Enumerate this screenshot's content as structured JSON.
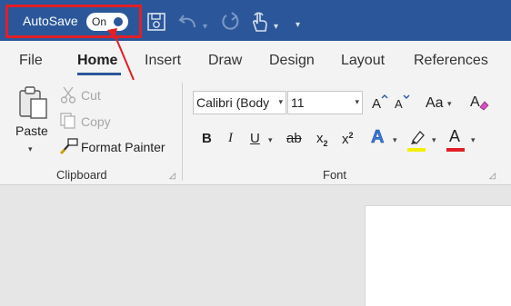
{
  "titlebar": {
    "autosave_label": "AutoSave",
    "autosave_state": "On",
    "icons": [
      "save-icon",
      "undo-icon",
      "redo-icon",
      "touch-mode-icon",
      "customize-toolbar-icon"
    ]
  },
  "tabs": {
    "file": "File",
    "home": "Home",
    "insert": "Insert",
    "draw": "Draw",
    "design": "Design",
    "layout": "Layout",
    "references": "References"
  },
  "clipboard": {
    "paste": "Paste",
    "cut": "Cut",
    "copy": "Copy",
    "format_painter": "Format Painter",
    "group_label": "Clipboard"
  },
  "font": {
    "font_name": "Calibri (Body",
    "font_size": "11",
    "change_case": "Aa",
    "bold": "B",
    "italic": "I",
    "underline": "U",
    "strikethrough": "ab",
    "subscript_base": "x",
    "subscript_mark": "2",
    "superscript_base": "x",
    "superscript_mark": "2",
    "text_effects": "A",
    "highlight_color": "#f5f000",
    "font_color_letter": "A",
    "font_color": "#e11f26",
    "group_label": "Font"
  },
  "colors": {
    "title_bar": "#2b579a",
    "annotation": "#e11f26"
  }
}
